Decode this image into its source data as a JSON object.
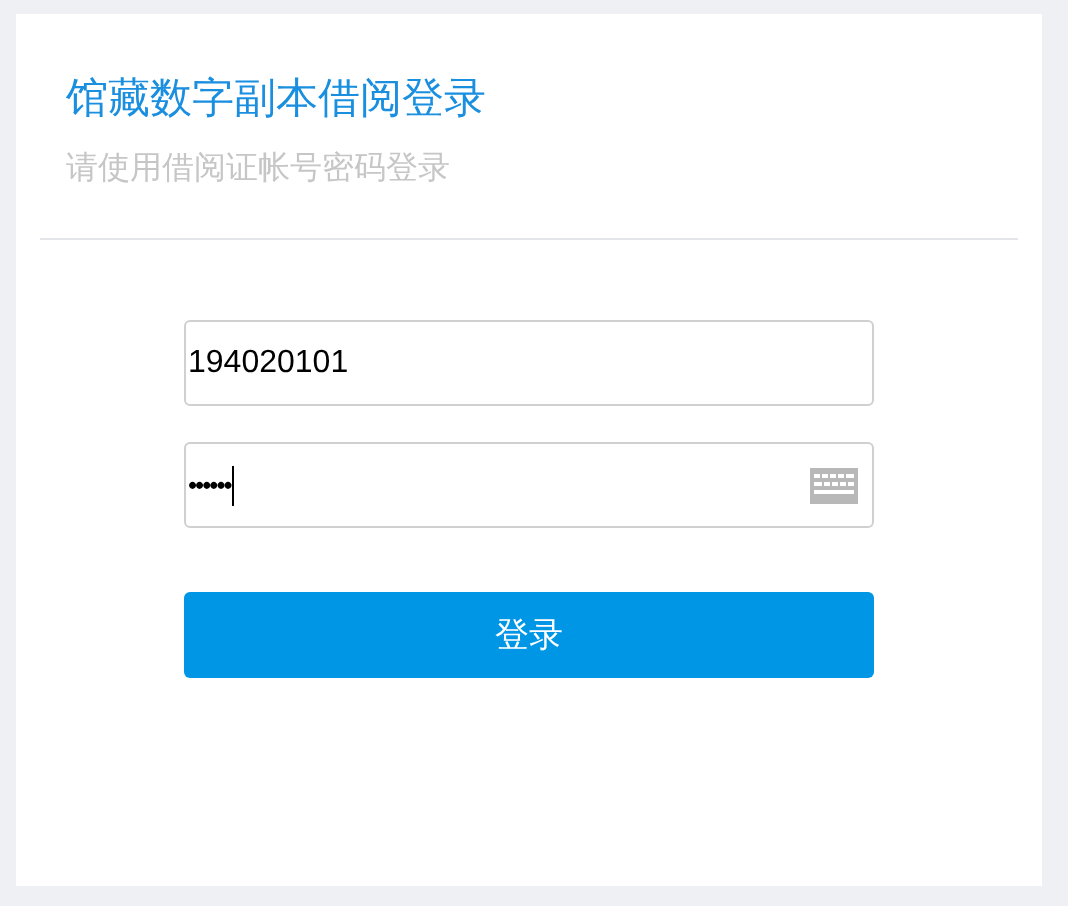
{
  "title": "馆藏数字副本借阅登录",
  "subtitle": "请使用借阅证帐号密码登录",
  "username": {
    "value": "194020101"
  },
  "password": {
    "value": "••••••",
    "focused": true
  },
  "login_button": {
    "label": "登录"
  }
}
